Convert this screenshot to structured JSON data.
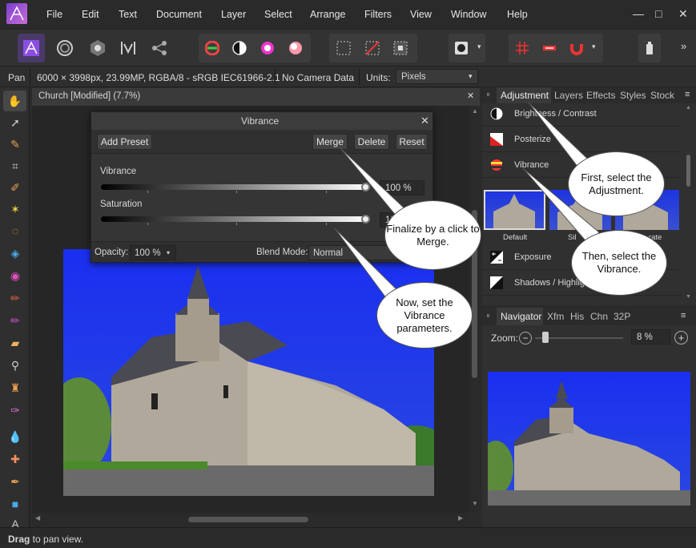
{
  "menu": [
    "File",
    "Edit",
    "Text",
    "Document",
    "Layer",
    "Select",
    "Arrange",
    "Filters",
    "View",
    "Window",
    "Help"
  ],
  "window_controls": {
    "minimize": "—",
    "maximize": "□",
    "close": "✕"
  },
  "toolbar": {
    "more": "»"
  },
  "context": {
    "tool": "Pan",
    "info": "6000 × 3998px, 23.99MP, RGBA/8 - sRGB IEC61966-2.1",
    "camera": "No Camera Data",
    "units_label": "Units:",
    "units_value": "Pixels"
  },
  "document": {
    "tab_title": "Church [Modified] (7.7%)",
    "close": "✕"
  },
  "dialog": {
    "title": "Vibrance",
    "close": "✕",
    "add_preset": "Add Preset",
    "merge": "Merge",
    "delete": "Delete",
    "reset": "Reset",
    "vibrance_label": "Vibrance",
    "vibrance_value": "100 %",
    "vibrance_level": 1.0,
    "saturation_label": "Saturation",
    "saturation_value": "100 %",
    "saturation_level": 1.0,
    "opacity_label": "Opacity:",
    "opacity_value": "100 %",
    "blend_label": "Blend Mode:",
    "blend_value": "Normal"
  },
  "right_panel": {
    "tabs": [
      "Adjustment",
      "Layers",
      "Effects",
      "Styles",
      "Stock"
    ],
    "active_tab": "Adjustment",
    "adjustments": [
      "Brightness / Contrast",
      "Posterize",
      "Vibrance",
      "Exposure",
      "Shadows / Highlights"
    ],
    "presets": [
      "Default",
      "Sil",
      "...rate"
    ]
  },
  "navigator": {
    "tabs": [
      "Navigator",
      "Xfm",
      "His",
      "Chn",
      "32P"
    ],
    "zoom_label": "Zoom:",
    "zoom_value": "8 %",
    "zoom_level": 0.08
  },
  "callouts": {
    "first": "First, select the Adjustment.",
    "then": "Then, select the Vibrance.",
    "finalize": "Finalize by a click to Merge.",
    "now": "Now, set the Vibrance parameters."
  },
  "status": {
    "bold": "Drag",
    "rest": " to pan view."
  },
  "colors": {
    "accent": "#8b4fe0",
    "sky": "#1a2fe6",
    "panel": "#303030"
  }
}
